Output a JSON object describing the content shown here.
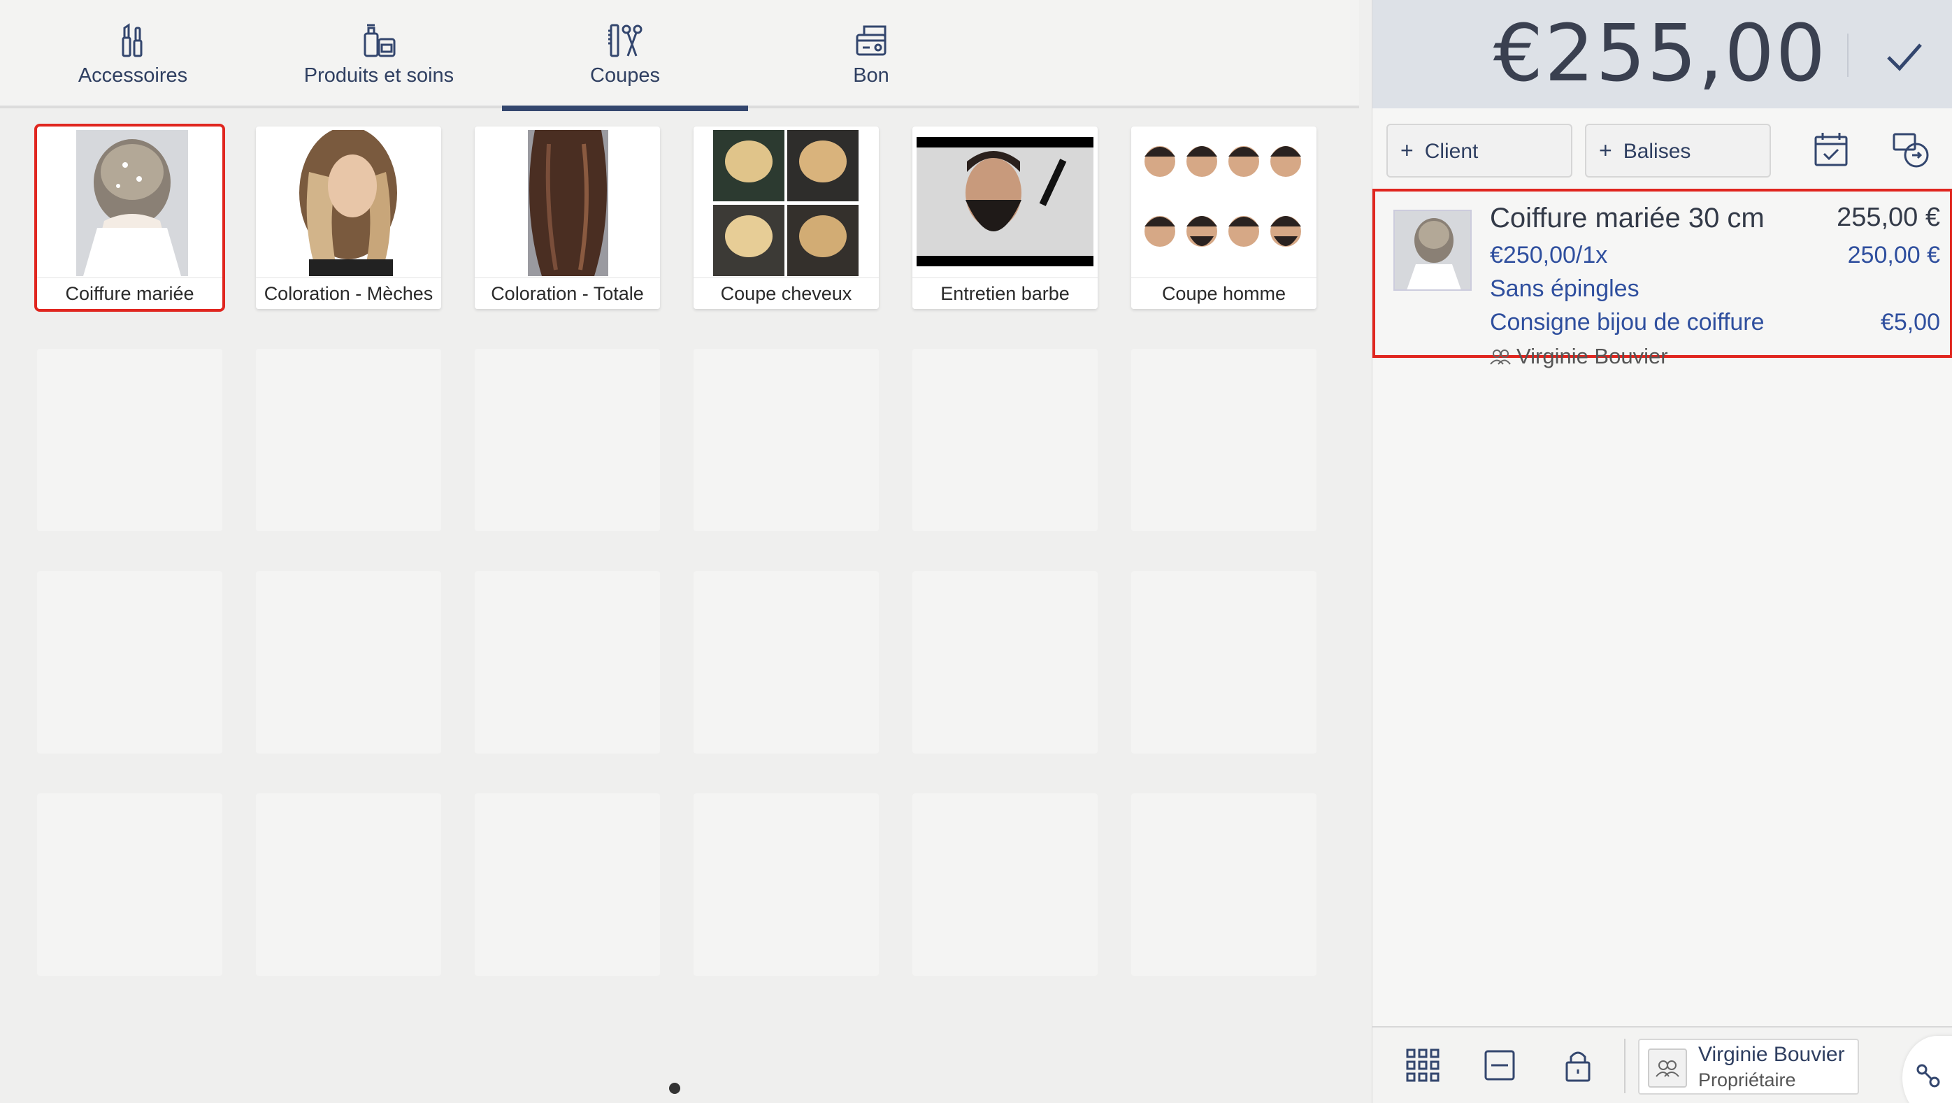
{
  "tabs": [
    {
      "label": "Accessoires",
      "icon": "cosmetics-icon",
      "active": false
    },
    {
      "label": "Produits et soins",
      "icon": "bottles-icon",
      "active": false
    },
    {
      "label": "Coupes",
      "icon": "comb-scissors-icon",
      "active": true
    },
    {
      "label": "Bon",
      "icon": "voucher-icon",
      "active": false
    }
  ],
  "products": [
    {
      "label": "Coiffure mariée",
      "image": "bridal-hairstyle-photo",
      "selected": true
    },
    {
      "label": "Coloration - Mèches",
      "image": "balayage-hair-photo",
      "selected": false
    },
    {
      "label": "Coloration - Totale",
      "image": "brown-long-hair-photo",
      "selected": false
    },
    {
      "label": "Coupe cheveux",
      "image": "short-blonde-cuts-collage",
      "selected": false
    },
    {
      "label": "Entretien barbe",
      "image": "bearded-man-comb-photo",
      "selected": false
    },
    {
      "label": "Coupe homme",
      "image": "mens-haircuts-collage",
      "selected": false
    }
  ],
  "cart": {
    "total": "€255,00",
    "client_button": "Client",
    "tags_button": "Balises",
    "item": {
      "name": "Coiffure mariée 30 cm",
      "price": "255,00 €",
      "unit_line": "€250,00/1x",
      "unit_total": "250,00 €",
      "option1": "Sans épingles",
      "option2": "Consigne bijou de coiffure",
      "option2_price": "€5,00",
      "staff": "Virginie Bouvier"
    }
  },
  "footer": {
    "user_name": "Virginie Bouvier",
    "user_role": "Propriétaire"
  },
  "colors": {
    "accent": "#33466e",
    "selection": "#e0261f",
    "link_blue": "#2f4f9e"
  }
}
